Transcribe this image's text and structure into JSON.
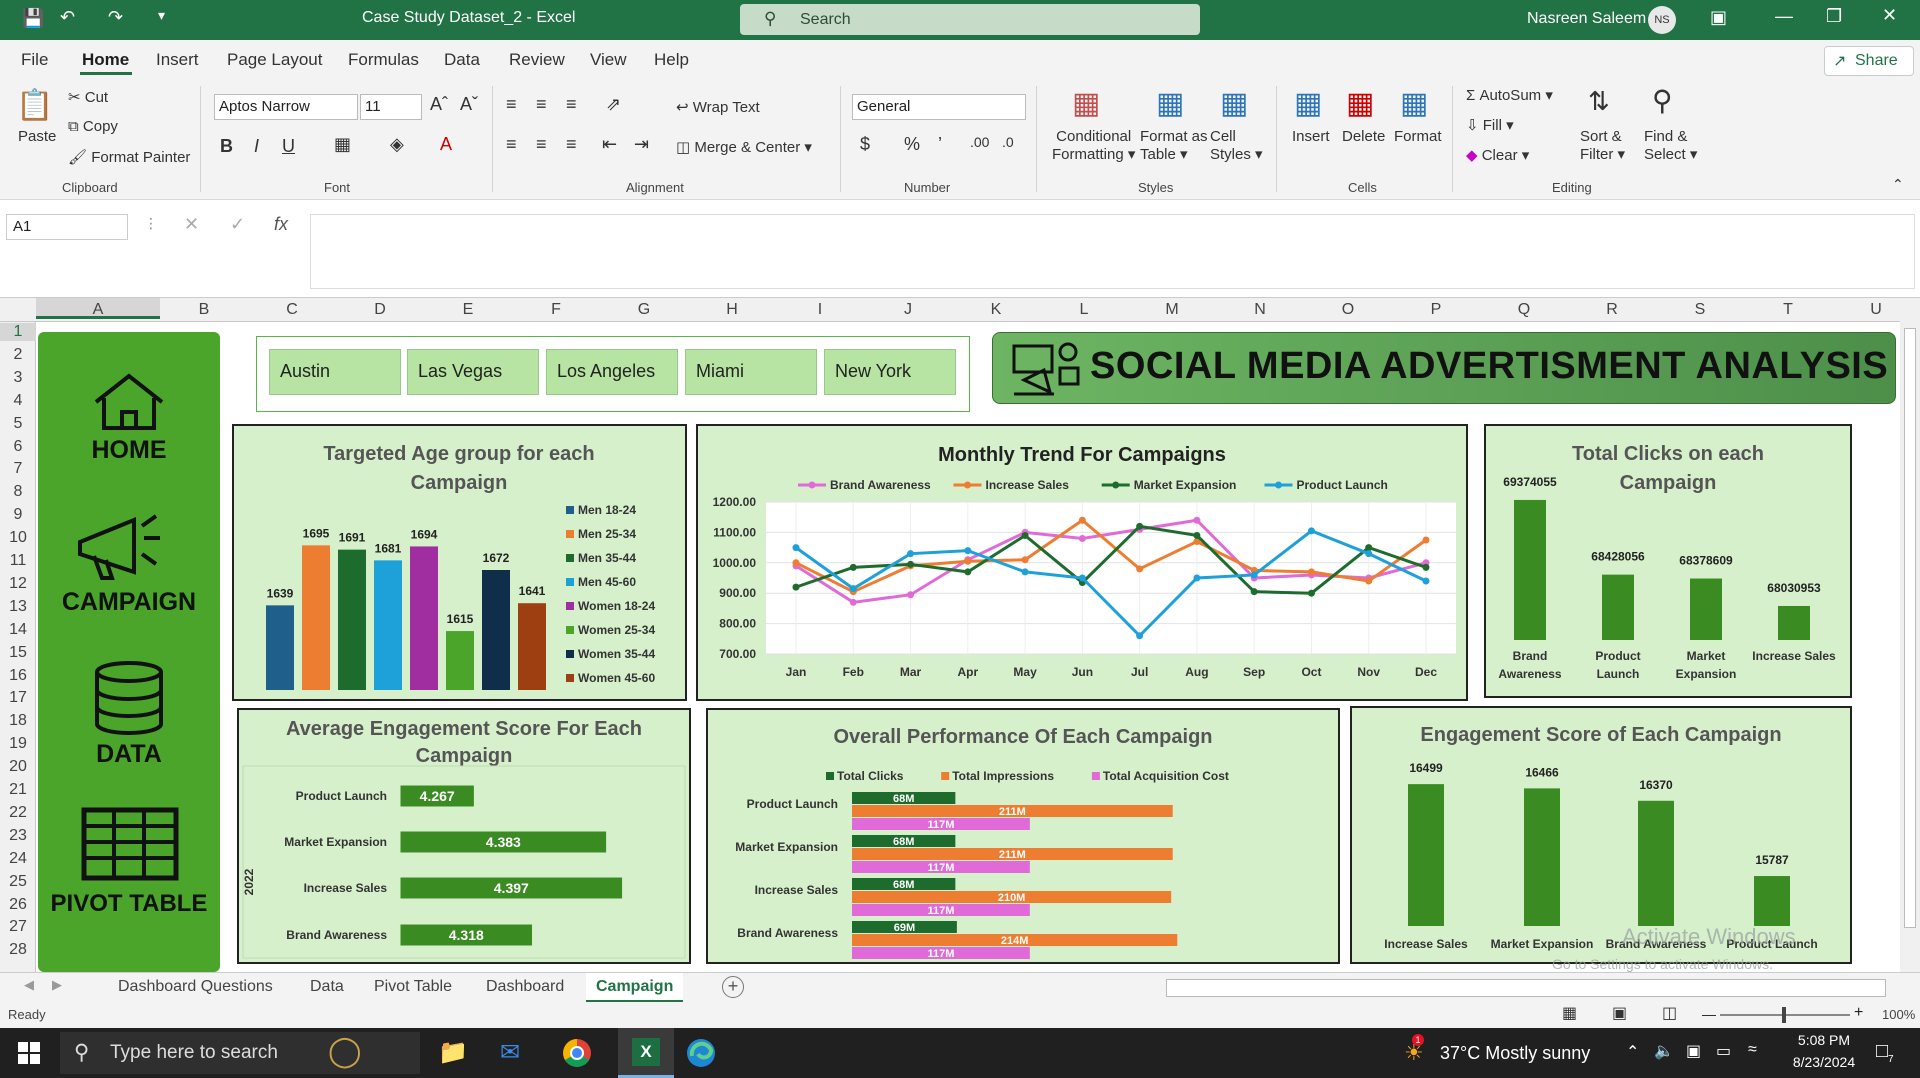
{
  "title_bar": {
    "doc_title": "Case Study Dataset_2  -  Excel",
    "search_placeholder": "Search",
    "user_name": "Nasreen Saleem",
    "user_initials": "NS"
  },
  "menu": {
    "items": [
      "File",
      "Home",
      "Insert",
      "Page Layout",
      "Formulas",
      "Data",
      "Review",
      "View",
      "Help"
    ],
    "share": "Share"
  },
  "ribbon": {
    "clipboard": {
      "paste": "Paste",
      "cut": "Cut",
      "copy": "Copy",
      "format_painter": "Format Painter",
      "label": "Clipboard"
    },
    "font": {
      "name": "Aptos Narrow",
      "size": "11",
      "label": "Font"
    },
    "alignment": {
      "wrap": "Wrap Text",
      "merge": "Merge & Center",
      "label": "Alignment"
    },
    "number": {
      "format": "General",
      "label": "Number"
    },
    "styles": {
      "conditional": "Conditional",
      "conditional2": "Formatting",
      "format_table": "Format as",
      "format_table2": "Table",
      "cell_styles": "Cell",
      "cell_styles2": "Styles",
      "label": "Styles"
    },
    "cells": {
      "insert": "Insert",
      "delete": "Delete",
      "format": "Format",
      "label": "Cells"
    },
    "editing": {
      "autosum": "AutoSum",
      "fill": "Fill",
      "clear": "Clear",
      "sort": "Sort &",
      "sort2": "Filter",
      "find": "Find &",
      "find2": "Select",
      "label": "Editing"
    }
  },
  "formula_bar": {
    "name_box": "A1",
    "fx": "fx"
  },
  "columns": [
    "A",
    "B",
    "C",
    "D",
    "E",
    "F",
    "G",
    "H",
    "I",
    "J",
    "K",
    "L",
    "M",
    "N",
    "O",
    "P",
    "Q",
    "R",
    "S",
    "T",
    "U"
  ],
  "rows": [
    "1",
    "2",
    "3",
    "4",
    "5",
    "6",
    "7",
    "8",
    "9",
    "10",
    "11",
    "12",
    "13",
    "14",
    "15",
    "16",
    "17",
    "18",
    "19",
    "20",
    "21",
    "22",
    "23",
    "24",
    "25",
    "26",
    "27",
    "28"
  ],
  "sidebar": {
    "home": "HOME",
    "campaign": "CAMPAIGN",
    "data": "DATA",
    "pivot": "PIVOT TABLE"
  },
  "cities": [
    "Austin",
    "Las Vegas",
    "Los Angeles",
    "Miami",
    "New York"
  ],
  "banner": {
    "title": "SOCIAL MEDIA ADVERTISMENT ANALYSIS"
  },
  "chart_data": [
    {
      "type": "bar",
      "title": "Targeted Age group for each Campaign",
      "categories": [
        "Men 18-24",
        "Men 25-34",
        "Men 35-44",
        "Men 45-60",
        "Women 18-24",
        "Women 25-34",
        "Women 35-44",
        "Women 45-60"
      ],
      "values": [
        1639,
        1695,
        1691,
        1681,
        1694,
        1615,
        1672,
        1641
      ],
      "colors": [
        "#1f5f8b",
        "#ed7d31",
        "#1e6b2e",
        "#1da1d8",
        "#a12ea1",
        "#4aa52a",
        "#0e2e4a",
        "#9e3f12"
      ],
      "legend": "right"
    },
    {
      "type": "line",
      "title": "Monthly Trend For Campaigns",
      "categories": [
        "Jan",
        "Feb",
        "Mar",
        "Apr",
        "May",
        "Jun",
        "Jul",
        "Aug",
        "Sep",
        "Oct",
        "Nov",
        "Dec"
      ],
      "ylim": [
        700,
        1200
      ],
      "yticks": [
        "1200.00",
        "1100.00",
        "1000.00",
        "900.00",
        "800.00",
        "700.00"
      ],
      "series": [
        {
          "name": "Brand Awareness",
          "color": "#e06ad8",
          "values": [
            990,
            870,
            895,
            1010,
            1100,
            1080,
            1110,
            1140,
            950,
            960,
            950,
            1000
          ]
        },
        {
          "name": "Increase Sales",
          "color": "#ed7d31",
          "values": [
            1000,
            905,
            990,
            1005,
            1010,
            1140,
            980,
            1070,
            975,
            970,
            940,
            1075
          ]
        },
        {
          "name": "Market Expansion",
          "color": "#1e6b2e",
          "values": [
            920,
            985,
            995,
            970,
            1090,
            935,
            1120,
            1090,
            905,
            900,
            1050,
            985
          ]
        },
        {
          "name": "Product Launch",
          "color": "#1da1d8",
          "values": [
            1050,
            915,
            1030,
            1040,
            970,
            950,
            760,
            950,
            960,
            1105,
            1030,
            940
          ]
        }
      ],
      "legend": "top"
    },
    {
      "type": "bar",
      "title": "Total Clicks on each Campaign",
      "categories": [
        "Brand Awareness",
        "Product Launch",
        "Market Expansion",
        "Increase Sales"
      ],
      "values": [
        69374055,
        68428056,
        68378609,
        68030953
      ]
    },
    {
      "type": "bar",
      "title": "Average Engagement Score For Each Campaign",
      "orientation": "horizontal",
      "group_label": "2022",
      "categories": [
        "Product Launch",
        "Market Expansion",
        "Increase Sales",
        "Brand Awareness"
      ],
      "values": [
        4.267,
        4.383,
        4.397,
        4.318
      ]
    },
    {
      "type": "bar",
      "title": "Overall Performance Of Each Campaign",
      "orientation": "horizontal",
      "categories": [
        "Product Launch",
        "Market Expansion",
        "Increase Sales",
        "Brand Awareness"
      ],
      "series": [
        {
          "name": "Total Clicks",
          "color": "#1e6b2e",
          "values": [
            68,
            68,
            68,
            69
          ],
          "labels": [
            "68M",
            "68M",
            "68M",
            "69M"
          ]
        },
        {
          "name": "Total Impressions",
          "color": "#ed7d31",
          "values": [
            211,
            211,
            210,
            214
          ],
          "labels": [
            "211M",
            "211M",
            "210M",
            "214M"
          ]
        },
        {
          "name": "Total Acquisition Cost",
          "color": "#e06ad8",
          "values": [
            117,
            117,
            117,
            117
          ],
          "labels": [
            "117M",
            "117M",
            "117M",
            "117M"
          ]
        }
      ],
      "legend": "top"
    },
    {
      "type": "bar",
      "title": "Engagement Score of Each Campaign",
      "categories": [
        "Increase Sales",
        "Market Expansion",
        "Brand Awareness",
        "Product Launch"
      ],
      "values": [
        16499,
        16466,
        16370,
        15787
      ]
    }
  ],
  "watermark": {
    "line1": "Activate Windows",
    "line2": "Go to Settings to activate Windows."
  },
  "sheet_tabs": [
    "Dashboard Questions",
    "Data",
    "Pivot Table",
    "Dashboard",
    "Campaign"
  ],
  "status": {
    "ready": "Ready",
    "zoom": "100%"
  },
  "taskbar": {
    "search": "Type here to search",
    "weather": "37°C  Mostly sunny",
    "time": "5:08 PM",
    "date": "8/23/2024",
    "badge": "7"
  }
}
